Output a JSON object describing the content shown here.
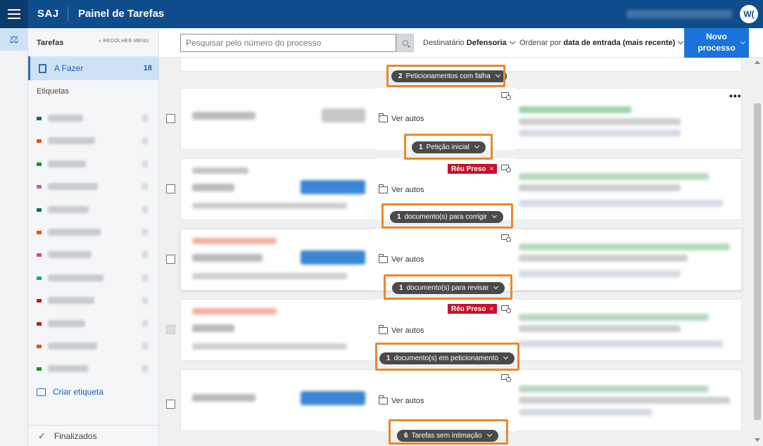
{
  "header": {
    "brand": "SAJ",
    "title": "Painel de Tarefas",
    "avatar_initials": "W("
  },
  "sidebar": {
    "section_title": "Tarefas",
    "collapse_label": "RECOLHER MENU",
    "active_item": {
      "label": "A Fazer",
      "count": "18"
    },
    "labels_title": "Etiquetas",
    "tag_colors": [
      "#0e6a6a",
      "#e0531b",
      "#1f8a2e",
      "#c25db0",
      "#0e6a6a",
      "#e0531b",
      "#e03ea3",
      "#1aa3a3",
      "#b81f1f",
      "#b81f1f",
      "#e0531b",
      "#1f8a2e"
    ],
    "create_label": "Criar etiqueta",
    "finished_label": "Finalizados"
  },
  "toolbar": {
    "search_placeholder": "Pesquisar pelo número do processo",
    "recipient_prefix": "Destinatário",
    "recipient_value": "Defensoria",
    "order_prefix": "Ordenar por",
    "order_value": "data de entrada (mais recente)",
    "new_button_line1": "Novo",
    "new_button_line2": "processo"
  },
  "cards": [
    {
      "view_label": "Ver autos",
      "badge": "",
      "pill_count": "1",
      "pill_label": "Petição inicial"
    },
    {
      "view_label": "Ver autos",
      "badge": "Réu Preso",
      "pill_count": "1",
      "pill_label": "documento(s) para corrigir"
    },
    {
      "view_label": "Ver autos",
      "badge": "",
      "pill_count": "1",
      "pill_label": "documento(s) para revisar"
    },
    {
      "view_label": "Ver autos",
      "badge": "Réu Preso",
      "pill_count": "1",
      "pill_label": "documento(s) em peticionamento"
    },
    {
      "view_label": "Ver autos",
      "badge": "",
      "pill_count": "6",
      "pill_label": "Tarefas sem intimação"
    }
  ],
  "top_pill": {
    "count": "2",
    "label": "Peticionamentos com falha"
  },
  "more_menu": "•••",
  "colors": {
    "header": "#0f4c8c",
    "accent": "#1a73d9",
    "highlight": "#e8892c",
    "badge": "#c8102e"
  }
}
